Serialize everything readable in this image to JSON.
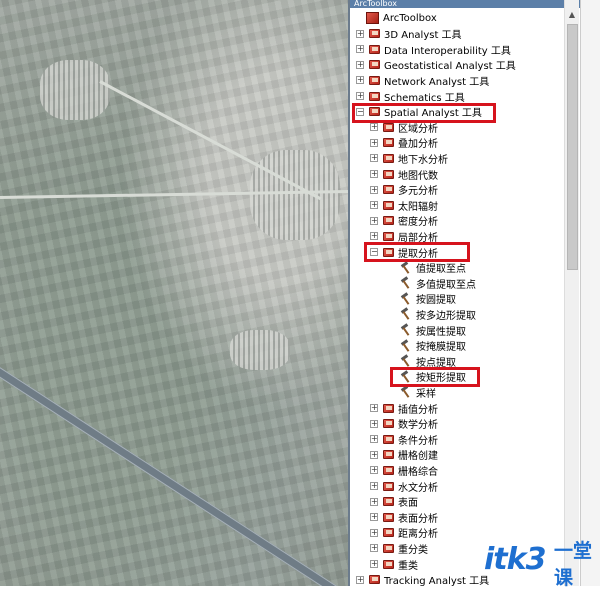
{
  "window": {
    "title": "ArcToolbox"
  },
  "tree": {
    "root_label": "ArcToolbox",
    "toolboxes": [
      {
        "label": "3D Analyst 工具",
        "expander": "+"
      },
      {
        "label": "Data Interoperability 工具",
        "expander": "+"
      },
      {
        "label": "Geostatistical Analyst 工具",
        "expander": "+"
      },
      {
        "label": "Network Analyst 工具",
        "expander": "+"
      },
      {
        "label": "Schematics 工具",
        "expander": "+"
      },
      {
        "label": "Spatial Analyst 工具",
        "expander": "−"
      }
    ],
    "spatial_children_a": [
      {
        "label": "区域分析",
        "expander": "+"
      },
      {
        "label": "叠加分析",
        "expander": "+"
      },
      {
        "label": "地下水分析",
        "expander": "+"
      },
      {
        "label": "地图代数",
        "expander": "+"
      },
      {
        "label": "多元分析",
        "expander": "+"
      },
      {
        "label": "太阳辐射",
        "expander": "+"
      },
      {
        "label": "密度分析",
        "expander": "+"
      },
      {
        "label": "局部分析",
        "expander": "+"
      },
      {
        "label": "提取分析",
        "expander": "−"
      }
    ],
    "extraction_tools": [
      {
        "label": "值提取至点"
      },
      {
        "label": "多值提取至点"
      },
      {
        "label": "按圆提取"
      },
      {
        "label": "按多边形提取"
      },
      {
        "label": "按属性提取"
      },
      {
        "label": "按掩膜提取"
      },
      {
        "label": "按点提取"
      },
      {
        "label": "按矩形提取"
      },
      {
        "label": "采样"
      }
    ],
    "spatial_children_b": [
      {
        "label": "插值分析",
        "expander": "+"
      },
      {
        "label": "数学分析",
        "expander": "+"
      },
      {
        "label": "条件分析",
        "expander": "+"
      },
      {
        "label": "栅格创建",
        "expander": "+"
      },
      {
        "label": "栅格综合",
        "expander": "+"
      },
      {
        "label": "水文分析",
        "expander": "+"
      },
      {
        "label": "表面",
        "expander": "+"
      },
      {
        "label": "表面分析",
        "expander": "+"
      },
      {
        "label": "距离分析",
        "expander": "+"
      },
      {
        "label": "重分类",
        "expander": "+"
      },
      {
        "label": "重类",
        "expander": "+"
      }
    ],
    "last_partial": {
      "label": "Tracking Analyst 工具",
      "expander": "+"
    }
  },
  "scrollbar": {
    "up_glyph": "▲"
  },
  "watermark": {
    "text": "itk3",
    "cn": "一堂课"
  },
  "colors": {
    "highlight": "#d6131d",
    "title_bar": "#5c7fa8",
    "watermark": "#1e6fd0"
  }
}
